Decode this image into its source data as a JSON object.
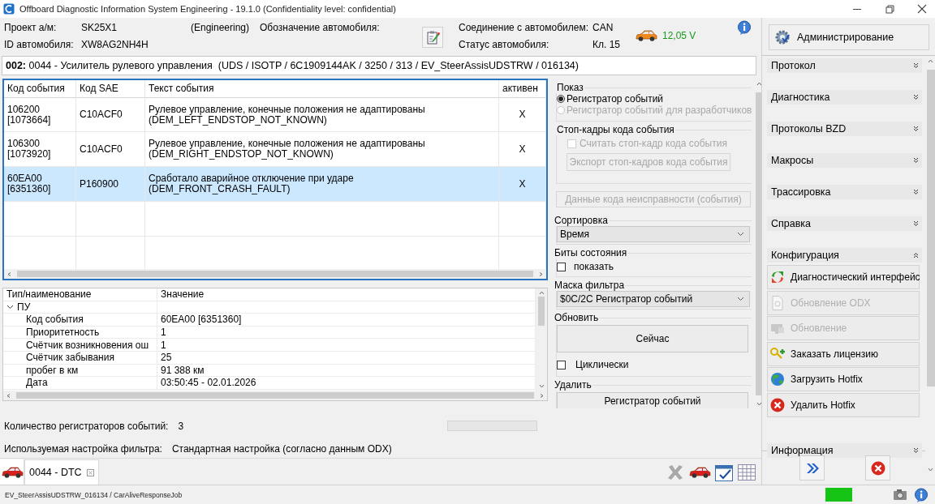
{
  "window": {
    "title": "Offboard Diagnostic Information System Engineering - 19.1.0 (Confidentiality level: confidential)"
  },
  "header": {
    "vehicle": [
      {
        "label": "Проект а/м:",
        "value": "SK25X1"
      },
      {
        "label": "ID автомобиля:",
        "value": "XW8AG2NH4H"
      }
    ],
    "mode": "(Engineering)",
    "designation_label": "Обозначение автомобиля:",
    "connection": [
      {
        "label": "Соединение с автомобилем:",
        "value": "CAN"
      },
      {
        "label": "Статус автомобиля:",
        "value": "Кл. 15"
      }
    ],
    "voltage": "12,05 V"
  },
  "module": {
    "title": "**002:** 0044 - Усилитель рулевого управления  (UDS / ISOTP / 6C1909144AK / 3250 / 313 / EV_SteerAssisUDSTRW / 016134)"
  },
  "events_table": {
    "columns": [
      "Код события",
      "Код SAE",
      "Текст события",
      "активен"
    ],
    "rows": [
      {
        "code": "106200\n[1073664]",
        "sae": "C10ACF0",
        "text": "Рулевое управление, конечные положения не адаптированы\n(DEM_LEFT_ENDSTOP_NOT_KNOWN)",
        "active": "X",
        "selected": false
      },
      {
        "code": "106300\n[1073920]",
        "sae": "C10ACF0",
        "text": "Рулевое управление, конечные положения не адаптированы\n(DEM_RIGHT_ENDSTOP_NOT_KNOWN)",
        "active": "X",
        "selected": false
      },
      {
        "code": "60EA00\n[6351360]",
        "sae": "P160900",
        "text": "Сработало аварийное отключение при ударе\n(DEM_FRONT_CRASH_FAULT)",
        "active": "X",
        "selected": true
      }
    ]
  },
  "details": {
    "columns": [
      "Тип/наименование",
      "Значение"
    ],
    "tree": [
      {
        "label": "ПУ",
        "expanded": true,
        "children": [
          {
            "label": "Код события",
            "value": "60EA00 [6351360]"
          },
          {
            "label": "Приоритетность",
            "value": "1"
          },
          {
            "label": "Счётчик возникновения ош",
            "value": "1"
          },
          {
            "label": "Счётчик забывания",
            "value": "25"
          },
          {
            "label": "пробег в км",
            "value": "91 388 км"
          },
          {
            "label": "Дата",
            "value": "03:50:45 - 02.01.2026"
          }
        ]
      }
    ]
  },
  "options": {
    "display": {
      "legend": "Показ",
      "radios": [
        {
          "label": "Регистратор событий",
          "selected": true,
          "disabled": false
        },
        {
          "label": "Регистратор событий для разработчиков",
          "selected": false,
          "disabled": true
        }
      ]
    },
    "freeze_frames": {
      "legend": "Стоп-кадры кода события",
      "checkbox": {
        "label": "Считать стоп-кадр кода события",
        "checked": false,
        "disabled": true
      },
      "button": {
        "label": "Экспорт стоп-кадров кода события",
        "disabled": true
      }
    },
    "fault_data_button": {
      "label": "Данные кода неисправности (события)",
      "disabled": true
    },
    "sorting": {
      "legend": "Сортировка",
      "value": "Время"
    },
    "status_bits": {
      "legend": "Биты состояния",
      "checkbox": {
        "label": "показать",
        "checked": false
      }
    },
    "filter_mask": {
      "legend": "Маска фильтра",
      "value": "$0C/2C Регистратор событий"
    },
    "refresh": {
      "legend": "Обновить",
      "button": "Сейчас",
      "cyclic": {
        "label": "Циклически",
        "checked": false
      }
    },
    "delete": {
      "legend": "Удалить",
      "button": "Регистратор событий"
    }
  },
  "summary": {
    "count_label": "Количество регистраторов событий:",
    "count": "3",
    "progress": {
      "level": 0
    },
    "filter_label": "Используемая настройка фильтра:",
    "filter": "Стандартная настройка (согласно данным ODX)"
  },
  "tabs": [
    {
      "label": "0044 - DTC",
      "selected": true
    }
  ],
  "sidebar": {
    "admin_button": "Администрирование",
    "sections": [
      {
        "title": "Протокол",
        "expanded": false
      },
      {
        "title": "Диагностика",
        "expanded": false
      },
      {
        "title": "Протоколы BZD",
        "expanded": false
      },
      {
        "title": "Макросы",
        "expanded": false
      },
      {
        "title": "Трассировка",
        "expanded": false
      },
      {
        "title": "Справка",
        "expanded": false
      },
      {
        "title": "Конфигурация",
        "expanded": true,
        "items": [
          {
            "label": "Диагностический интерфейс",
            "kind": "interface",
            "disabled": false
          },
          {
            "label": "Обновление ODX",
            "kind": "document",
            "disabled": true
          },
          {
            "label": "Обновление",
            "kind": "monitor",
            "disabled": true
          },
          {
            "label": "Заказать лицензию",
            "kind": "key",
            "disabled": false
          },
          {
            "label": "Загрузить Hotfix",
            "kind": "globe",
            "disabled": false
          },
          {
            "label": "Удалить Hotfix",
            "kind": "remove",
            "disabled": false
          }
        ]
      },
      {
        "title": "Информация",
        "expanded": false
      }
    ]
  },
  "status_bar": {
    "text": "EV_SteerAssisUDSTRW_016134 / CarAliveResponseJob",
    "connected": true
  }
}
